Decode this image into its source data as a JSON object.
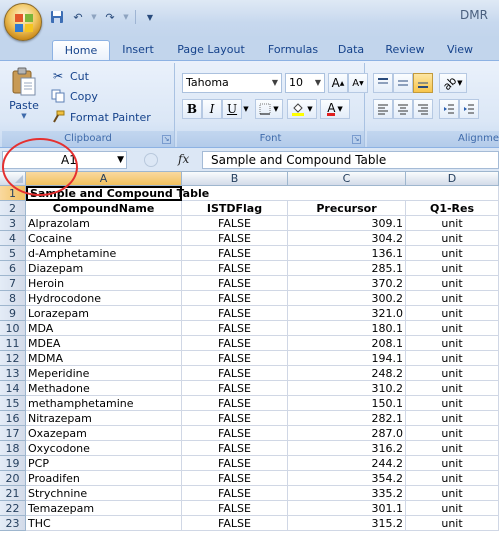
{
  "app": {
    "title": "DMR",
    "quick_access": [
      "save-icon",
      "undo-icon",
      "redo-icon",
      "customize-icon"
    ]
  },
  "tabs": [
    "Home",
    "Insert",
    "Page Layout",
    "Formulas",
    "Data",
    "Review",
    "View"
  ],
  "ribbon": {
    "clipboard": {
      "label": "Clipboard",
      "paste": "Paste",
      "cut": "Cut",
      "copy": "Copy",
      "format_painter": "Format Painter"
    },
    "font": {
      "label": "Font",
      "name": "Tahoma",
      "size": "10"
    },
    "alignment": {
      "label": "Alignme"
    }
  },
  "formula_bar": {
    "name_box": "A1",
    "fx": "fx",
    "content": "Sample and Compound Table"
  },
  "columns": [
    "A",
    "B",
    "C",
    "D"
  ],
  "sheet": {
    "title": "Sample and Compound Table",
    "headers": [
      "CompoundName",
      "ISTDFlag",
      "Precursor",
      "Q1-Res"
    ],
    "rows": [
      [
        "Alprazolam",
        "FALSE",
        "309.1",
        "unit"
      ],
      [
        "Cocaine",
        "FALSE",
        "304.2",
        "unit"
      ],
      [
        "d-Amphetamine",
        "FALSE",
        "136.1",
        "unit"
      ],
      [
        "Diazepam",
        "FALSE",
        "285.1",
        "unit"
      ],
      [
        "Heroin",
        "FALSE",
        "370.2",
        "unit"
      ],
      [
        "Hydrocodone",
        "FALSE",
        "300.2",
        "unit"
      ],
      [
        "Lorazepam",
        "FALSE",
        "321.0",
        "unit"
      ],
      [
        "MDA",
        "FALSE",
        "180.1",
        "unit"
      ],
      [
        "MDEA",
        "FALSE",
        "208.1",
        "unit"
      ],
      [
        "MDMA",
        "FALSE",
        "194.1",
        "unit"
      ],
      [
        "Meperidine",
        "FALSE",
        "248.2",
        "unit"
      ],
      [
        "Methadone",
        "FALSE",
        "310.2",
        "unit"
      ],
      [
        "methamphetamine",
        "FALSE",
        "150.1",
        "unit"
      ],
      [
        "Nitrazepam",
        "FALSE",
        "282.1",
        "unit"
      ],
      [
        "Oxazepam",
        "FALSE",
        "287.0",
        "unit"
      ],
      [
        "Oxycodone",
        "FALSE",
        "316.2",
        "unit"
      ],
      [
        "PCP",
        "FALSE",
        "244.2",
        "unit"
      ],
      [
        "Proadifen",
        "FALSE",
        "354.2",
        "unit"
      ],
      [
        "Strychnine",
        "FALSE",
        "335.2",
        "unit"
      ],
      [
        "Temazepam",
        "FALSE",
        "301.1",
        "unit"
      ],
      [
        "THC",
        "FALSE",
        "315.2",
        "unit"
      ]
    ]
  }
}
